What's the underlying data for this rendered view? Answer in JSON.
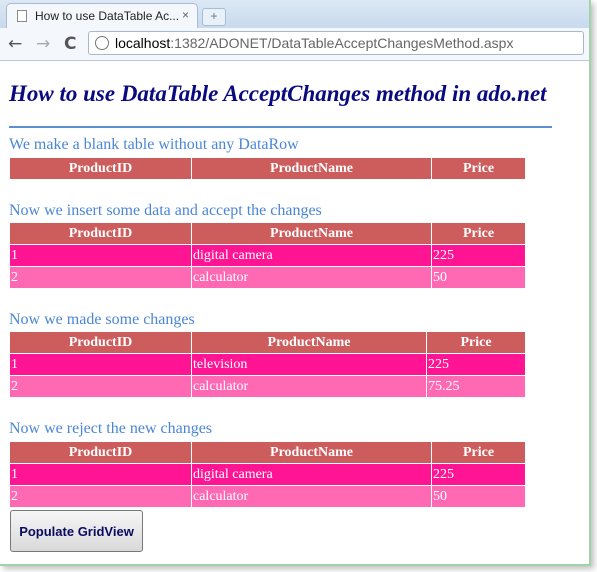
{
  "browser": {
    "tab_title": "How to use DataTable Ac...",
    "tab_close": "×",
    "new_tab": "+",
    "back": "←",
    "forward": "→",
    "reload": "C",
    "url_host": "localhost",
    "url_path": ":1382/ADONET/DataTableAcceptChangesMethod.aspx"
  },
  "page": {
    "title": "How to use DataTable AcceptChanges method in ado.net",
    "sections": [
      {
        "title": "We make a blank table without any DataRow",
        "headers": [
          "ProductID",
          "ProductName",
          "Price"
        ],
        "rows": []
      },
      {
        "title": "Now we insert some data and accept the changes",
        "headers": [
          "ProductID",
          "ProductName",
          "Price"
        ],
        "rows": [
          [
            "1",
            "digital camera",
            "225"
          ],
          [
            "2",
            "calculator",
            "50"
          ]
        ]
      },
      {
        "title": "Now we made some changes",
        "headers": [
          "ProductID",
          "ProductName",
          "Price"
        ],
        "rows": [
          [
            "1",
            "television",
            "225"
          ],
          [
            "2",
            "calculator",
            "75.25"
          ]
        ]
      },
      {
        "title": "Now we reject the new changes",
        "headers": [
          "ProductID",
          "ProductName",
          "Price"
        ],
        "rows": [
          [
            "1",
            "digital camera",
            "225"
          ],
          [
            "2",
            "calculator",
            "50"
          ]
        ]
      }
    ],
    "button_label": "Populate GridView"
  },
  "colors": {
    "header_bg": "#cd5c5c",
    "row_odd_bg": "#ff1493",
    "row_even_bg": "#ff69b4",
    "title_color": "#0a0a80",
    "section_color": "#4b86d6"
  }
}
